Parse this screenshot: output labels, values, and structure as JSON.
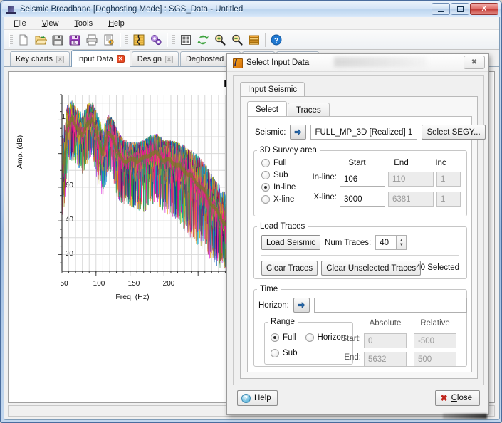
{
  "window": {
    "title": "Seismic Broadband [Deghosting Mode] : SGS_Data - Untitled",
    "minimize_label": "",
    "maximize_label": "",
    "close_label": "X"
  },
  "menubar": {
    "items": [
      {
        "label": "File"
      },
      {
        "label": "View"
      },
      {
        "label": "Tools"
      },
      {
        "label": "Help"
      }
    ]
  },
  "toolbar": {
    "buttons": [
      {
        "name": "new-icon",
        "title": "New"
      },
      {
        "name": "open-folder-icon",
        "title": "Open"
      },
      {
        "name": "save-icon",
        "title": "Save"
      },
      {
        "name": "save-as-icon",
        "title": "Save As"
      },
      {
        "name": "print-icon",
        "title": "Print"
      },
      {
        "name": "report-icon",
        "title": "Report"
      },
      {
        "name": "seismic-trace-icon",
        "title": "Seismic"
      },
      {
        "name": "settings-gears-icon",
        "title": "Settings"
      },
      {
        "name": "grid-layout-icon",
        "title": "Tile"
      },
      {
        "name": "refresh-icon",
        "title": "Refresh"
      },
      {
        "name": "zoom-in-icon",
        "title": "Zoom In"
      },
      {
        "name": "zoom-out-icon",
        "title": "Zoom Out"
      },
      {
        "name": "layers-icon",
        "title": "Layers"
      },
      {
        "name": "help-icon",
        "title": "Help"
      }
    ]
  },
  "tabs": [
    {
      "label": "Key charts",
      "active": false
    },
    {
      "label": "Input Data",
      "active": true
    },
    {
      "label": "Design",
      "active": false
    },
    {
      "label": "Deghosted",
      "active": false
    }
  ],
  "chart_data": {
    "type": "line",
    "title": "Raw Seismic",
    "xlabel": "Freq. (Hz)",
    "ylabel": "Amp. (dB)",
    "xlim": [
      0,
      250
    ],
    "ylim": [
      10,
      115
    ],
    "xticks": [
      50,
      100,
      150,
      200
    ],
    "yticks": [
      20,
      40,
      60,
      80,
      100
    ],
    "grid": true,
    "legend": "none",
    "series_count": 40,
    "description": "Overlaid amplitude spectra of 40 seismic traces, multi-colored",
    "envelope_x": [
      2,
      8,
      15,
      22,
      30,
      38,
      45,
      52,
      60,
      68,
      75,
      82,
      90,
      100,
      110,
      120,
      130,
      140,
      150,
      160,
      170,
      180,
      190,
      200,
      210,
      220,
      230,
      240,
      248
    ],
    "envelope_upper": [
      95,
      110,
      112,
      108,
      104,
      110,
      111,
      104,
      96,
      103,
      101,
      94,
      89,
      87,
      87,
      88,
      91,
      92,
      88,
      88,
      87,
      85,
      82,
      79,
      74,
      68,
      62,
      57,
      55
    ],
    "envelope_lower": [
      52,
      78,
      83,
      80,
      74,
      82,
      84,
      70,
      62,
      74,
      72,
      60,
      58,
      56,
      55,
      53,
      58,
      58,
      53,
      52,
      48,
      44,
      40,
      36,
      32,
      26,
      22,
      20,
      20
    ],
    "mean_values": [
      70,
      96,
      100,
      96,
      90,
      99,
      100,
      90,
      80,
      92,
      90,
      80,
      76,
      76,
      76,
      77,
      80,
      80,
      76,
      76,
      73,
      70,
      66,
      62,
      57,
      50,
      44,
      38,
      36
    ]
  },
  "dialog": {
    "title": "Select Input Data",
    "close_glyph": "✖",
    "outer_tab": "Input Seismic",
    "inner_tabs": [
      {
        "label": "Select",
        "active": true
      },
      {
        "label": "Traces",
        "active": false
      }
    ],
    "seismic": {
      "label": "Seismic:",
      "arrow_glyph": "➡",
      "value": "FULL_MP_3D [Realized] 1",
      "select_segy_button": "Select SEGY..."
    },
    "survey_area": {
      "legend": "3D Survey area",
      "radios": [
        {
          "label": "Full",
          "selected": false
        },
        {
          "label": "Sub",
          "selected": false
        },
        {
          "label": "In-line",
          "selected": true
        },
        {
          "label": "X-line",
          "selected": false
        }
      ],
      "columns": [
        "Start",
        "End",
        "Inc"
      ],
      "rows": [
        {
          "label": "In-line:",
          "start": "106",
          "end": "110",
          "inc": "1"
        },
        {
          "label": "X-line:",
          "start": "3000",
          "end": "6381",
          "inc": "1"
        }
      ]
    },
    "load_traces": {
      "legend": "Load Traces",
      "load_seismic_button": "Load Seismic",
      "num_traces_label": "Num Traces:",
      "num_traces_value": "40",
      "clear_traces_button": "Clear Traces",
      "clear_unselected_button": "Clear Unselected Traces",
      "selected_status": "40 Selected"
    },
    "time": {
      "legend": "Time",
      "horizon_label": "Horizon:",
      "horizon_arrow_glyph": "➡",
      "horizon_value": "",
      "range": {
        "legend": "Range",
        "radios": [
          {
            "label": "Full",
            "selected": true
          },
          {
            "label": "Horizon",
            "selected": false
          },
          {
            "label": "Sub",
            "selected": false
          }
        ]
      },
      "columns": [
        "Absolute",
        "Relative"
      ],
      "rows": [
        {
          "label": "Start:",
          "absolute": "0",
          "relative": "-500"
        },
        {
          "label": "End:",
          "absolute": "5632",
          "relative": "500"
        }
      ]
    },
    "footer": {
      "help_button": "Help",
      "close_button": "Close"
    }
  },
  "colors": {
    "accent": "#2a6099",
    "tab_close_active": "#e84a25",
    "close_x": "#c0241b",
    "titlebar_start": "#e9f2fb",
    "titlebar_end": "#bcd5ef"
  }
}
